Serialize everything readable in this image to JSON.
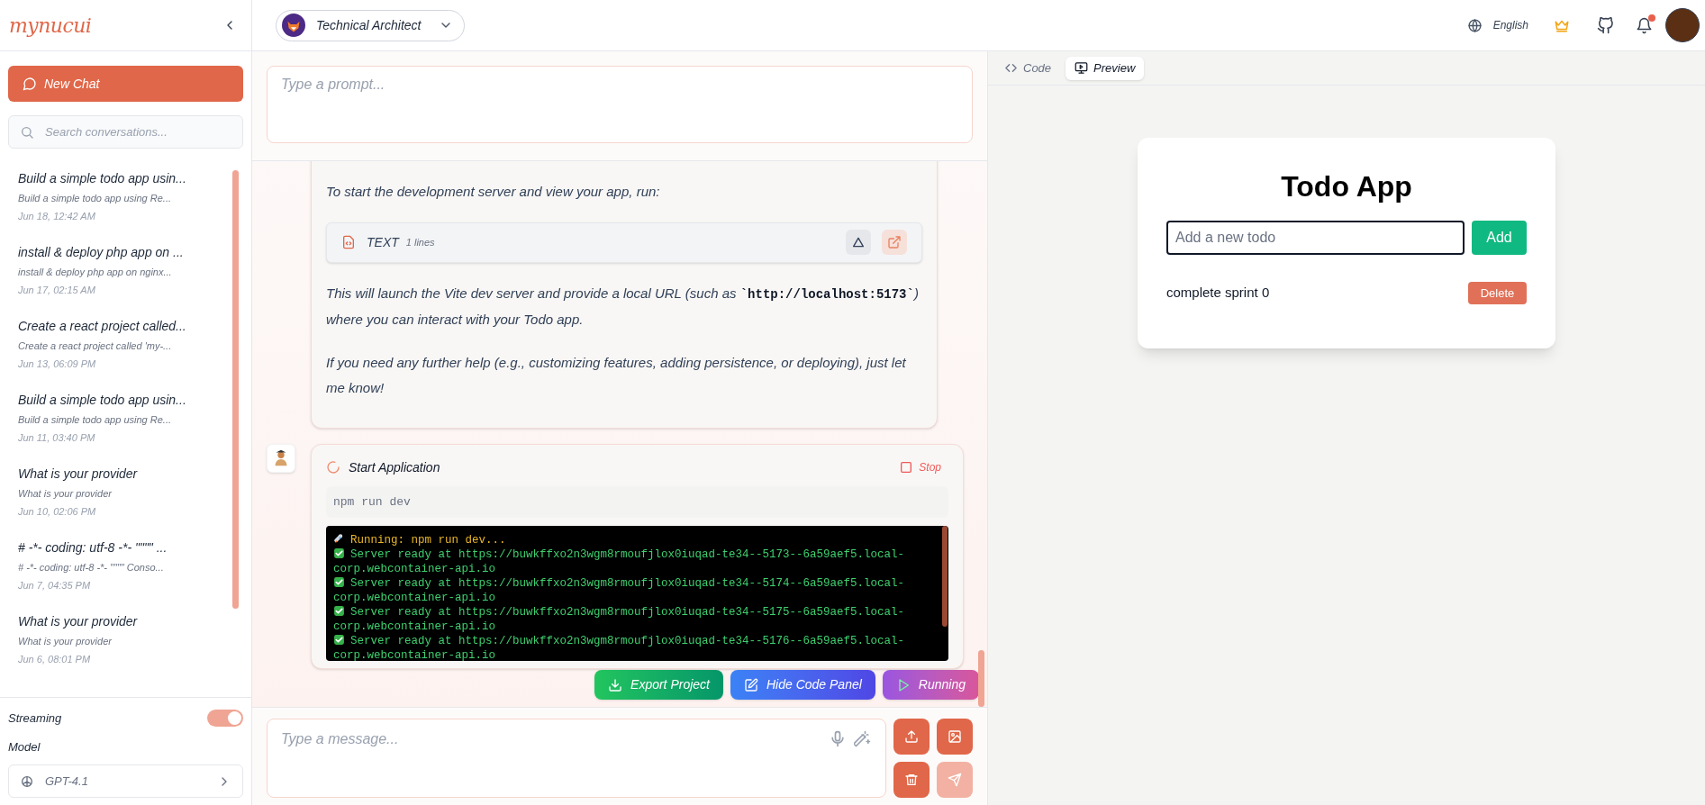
{
  "sidebar": {
    "logo": "mynucui",
    "new_chat": "New Chat",
    "search": {
      "placeholder": "Search conversations..."
    },
    "conversations": [
      {
        "title": "Build a simple todo app usin...",
        "preview": "Build a simple todo app using Re...",
        "date": "Jun 18, 12:42 AM"
      },
      {
        "title": "install & deploy php app on ...",
        "preview": "install & deploy php app on nginx...",
        "date": "Jun 17, 02:15 AM"
      },
      {
        "title": "Create a react project called...",
        "preview": "Create a react project called 'my-...",
        "date": "Jun 13, 06:09 PM"
      },
      {
        "title": "Build a simple todo app usin...",
        "preview": "Build a simple todo app using Re...",
        "date": "Jun 11, 03:40 PM"
      },
      {
        "title": "What is your provider",
        "preview": "What is your provider",
        "date": "Jun 10, 02:06 PM"
      },
      {
        "title": "# -*- coding: utf-8 -*- \"\"\"\" ...",
        "preview": "# -*- coding: utf-8 -*- \"\"\"\" Conso...",
        "date": "Jun 7, 04:35 PM"
      },
      {
        "title": "What is your provider",
        "preview": "What is your provider",
        "date": "Jun 6, 08:01 PM"
      }
    ],
    "streaming": {
      "label": "Streaming",
      "on": true
    },
    "model": {
      "label": "Model",
      "value": "GPT-4.1"
    }
  },
  "header": {
    "persona": "Technical Architect",
    "language": "English",
    "notification": true
  },
  "prompt": {
    "placeholder": "Type a prompt..."
  },
  "message": {
    "intro": "To start the development server and view your app, run:",
    "code_block": {
      "lang": "TEXT",
      "lines": "1 lines"
    },
    "paragraphs": [
      [
        {
          "kind": "text",
          "text": "This will launch the Vite dev server and provide a local URL (such as "
        },
        {
          "kind": "code",
          "text": "`http://localhost:5173`"
        },
        {
          "kind": "text",
          "text": ") where you can interact with your Todo app."
        }
      ],
      [
        {
          "kind": "text",
          "text": "If you need any further help (e.g., customizing features, adding persistence, or deploying), just let me know!"
        }
      ]
    ]
  },
  "task": {
    "title": "Start Application",
    "stop": "Stop",
    "command": "npm run dev",
    "terminal": [
      {
        "kind": "start",
        "text": "Running: npm run dev..."
      },
      {
        "kind": "ready",
        "text": "Server ready at https://buwkffxo2n3wgm8rmoufjlox0iuqad-te34--5173--6a59aef5.local-corp.webcontainer-api.io"
      },
      {
        "kind": "ready",
        "text": "Server ready at https://buwkffxo2n3wgm8rmoufjlox0iuqad-te34--5174--6a59aef5.local-corp.webcontainer-api.io"
      },
      {
        "kind": "ready",
        "text": "Server ready at https://buwkffxo2n3wgm8rmoufjlox0iuqad-te34--5175--6a59aef5.local-corp.webcontainer-api.io"
      },
      {
        "kind": "ready",
        "text": "Server ready at https://buwkffxo2n3wgm8rmoufjlox0iuqad-te34--5176--6a59aef5.local-corp.webcontainer-api.io"
      }
    ]
  },
  "actions": [
    {
      "kind": "export",
      "label": "Export Project",
      "disabled": false
    },
    {
      "kind": "hide",
      "label": "Hide Code Panel",
      "disabled": false
    },
    {
      "kind": "run",
      "label": "Running",
      "disabled": true
    }
  ],
  "composer": {
    "placeholder": "Type a message...",
    "send_disabled": true
  },
  "panel": {
    "tabs": [
      {
        "kind": "code",
        "label": "Code",
        "selected": false
      },
      {
        "kind": "preview",
        "label": "Preview",
        "selected": true
      }
    ],
    "preview": {
      "title": "Todo App",
      "input_placeholder": "Add a new todo",
      "add": "Add",
      "todos": [
        {
          "text": "complete sprint 0",
          "action": "Delete"
        }
      ]
    }
  }
}
